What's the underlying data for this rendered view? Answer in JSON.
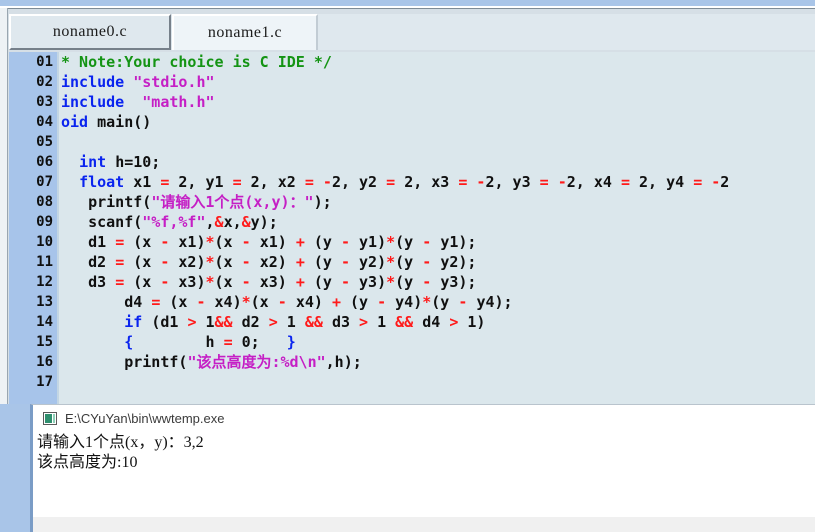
{
  "window": {
    "tabs": [
      {
        "label": "noname0.c",
        "active": false
      },
      {
        "label": "noname1.c",
        "active": true
      }
    ]
  },
  "editor": {
    "scrolled_horizontally": true,
    "lines": [
      {
        "num": "01",
        "segments": [
          {
            "text": "* Note:Your choice is C IDE */",
            "cls": "cm"
          }
        ]
      },
      {
        "num": "02",
        "segments": [
          {
            "text": "include ",
            "cls": "kw"
          },
          {
            "text": "\"stdio.h\"",
            "cls": "str"
          }
        ]
      },
      {
        "num": "03",
        "segments": [
          {
            "text": "include  ",
            "cls": "kw"
          },
          {
            "text": "\"math.h\"",
            "cls": "str"
          }
        ]
      },
      {
        "num": "04",
        "segments": [
          {
            "text": "oid ",
            "cls": "kw"
          },
          {
            "text": "main()",
            "cls": "pl"
          }
        ]
      },
      {
        "num": "05",
        "segments": [
          {
            "text": "",
            "cls": "pl"
          }
        ]
      },
      {
        "num": "06",
        "segments": [
          {
            "text": "  ",
            "cls": "pl"
          },
          {
            "text": "int ",
            "cls": "kw"
          },
          {
            "text": "h=10;",
            "cls": "pl"
          }
        ]
      },
      {
        "num": "07",
        "segments": [
          {
            "text": "  ",
            "cls": "pl"
          },
          {
            "text": "float ",
            "cls": "kw"
          },
          {
            "text": "x1 ",
            "cls": "pl"
          },
          {
            "text": "= ",
            "cls": "op"
          },
          {
            "text": "2, y1 ",
            "cls": "pl"
          },
          {
            "text": "= ",
            "cls": "op"
          },
          {
            "text": "2, x2 ",
            "cls": "pl"
          },
          {
            "text": "= -",
            "cls": "op"
          },
          {
            "text": "2, y2 ",
            "cls": "pl"
          },
          {
            "text": "= ",
            "cls": "op"
          },
          {
            "text": "2, x3 ",
            "cls": "pl"
          },
          {
            "text": "= -",
            "cls": "op"
          },
          {
            "text": "2, y3 ",
            "cls": "pl"
          },
          {
            "text": "= -",
            "cls": "op"
          },
          {
            "text": "2, x4 ",
            "cls": "pl"
          },
          {
            "text": "= ",
            "cls": "op"
          },
          {
            "text": "2, y4 ",
            "cls": "pl"
          },
          {
            "text": "= -",
            "cls": "op"
          },
          {
            "text": "2",
            "cls": "pl"
          }
        ]
      },
      {
        "num": "08",
        "segments": [
          {
            "text": "   printf(",
            "cls": "pl"
          },
          {
            "text": "\"请输入1个点(x,y)：\"",
            "cls": "str"
          },
          {
            "text": ");",
            "cls": "pl"
          }
        ]
      },
      {
        "num": "09",
        "segments": [
          {
            "text": "   scanf(",
            "cls": "pl"
          },
          {
            "text": "\"%f,%f\"",
            "cls": "str"
          },
          {
            "text": ",",
            "cls": "pl"
          },
          {
            "text": "&",
            "cls": "op"
          },
          {
            "text": "x,",
            "cls": "pl"
          },
          {
            "text": "&",
            "cls": "op"
          },
          {
            "text": "y);",
            "cls": "pl"
          }
        ]
      },
      {
        "num": "10",
        "segments": [
          {
            "text": "   d1 ",
            "cls": "pl"
          },
          {
            "text": "= ",
            "cls": "op"
          },
          {
            "text": "(x ",
            "cls": "pl"
          },
          {
            "text": "- ",
            "cls": "op"
          },
          {
            "text": "x1)",
            "cls": "pl"
          },
          {
            "text": "*",
            "cls": "op"
          },
          {
            "text": "(x ",
            "cls": "pl"
          },
          {
            "text": "- ",
            "cls": "op"
          },
          {
            "text": "x1) ",
            "cls": "pl"
          },
          {
            "text": "+ ",
            "cls": "op"
          },
          {
            "text": "(y ",
            "cls": "pl"
          },
          {
            "text": "- ",
            "cls": "op"
          },
          {
            "text": "y1)",
            "cls": "pl"
          },
          {
            "text": "*",
            "cls": "op"
          },
          {
            "text": "(y ",
            "cls": "pl"
          },
          {
            "text": "- ",
            "cls": "op"
          },
          {
            "text": "y1);",
            "cls": "pl"
          }
        ]
      },
      {
        "num": "11",
        "segments": [
          {
            "text": "   d2 ",
            "cls": "pl"
          },
          {
            "text": "= ",
            "cls": "op"
          },
          {
            "text": "(x ",
            "cls": "pl"
          },
          {
            "text": "- ",
            "cls": "op"
          },
          {
            "text": "x2)",
            "cls": "pl"
          },
          {
            "text": "*",
            "cls": "op"
          },
          {
            "text": "(x ",
            "cls": "pl"
          },
          {
            "text": "- ",
            "cls": "op"
          },
          {
            "text": "x2) ",
            "cls": "pl"
          },
          {
            "text": "+ ",
            "cls": "op"
          },
          {
            "text": "(y ",
            "cls": "pl"
          },
          {
            "text": "- ",
            "cls": "op"
          },
          {
            "text": "y2)",
            "cls": "pl"
          },
          {
            "text": "*",
            "cls": "op"
          },
          {
            "text": "(y ",
            "cls": "pl"
          },
          {
            "text": "- ",
            "cls": "op"
          },
          {
            "text": "y2);",
            "cls": "pl"
          }
        ]
      },
      {
        "num": "12",
        "segments": [
          {
            "text": "   d3 ",
            "cls": "pl"
          },
          {
            "text": "= ",
            "cls": "op"
          },
          {
            "text": "(x ",
            "cls": "pl"
          },
          {
            "text": "- ",
            "cls": "op"
          },
          {
            "text": "x3)",
            "cls": "pl"
          },
          {
            "text": "*",
            "cls": "op"
          },
          {
            "text": "(x ",
            "cls": "pl"
          },
          {
            "text": "- ",
            "cls": "op"
          },
          {
            "text": "x3) ",
            "cls": "pl"
          },
          {
            "text": "+ ",
            "cls": "op"
          },
          {
            "text": "(y ",
            "cls": "pl"
          },
          {
            "text": "- ",
            "cls": "op"
          },
          {
            "text": "y3)",
            "cls": "pl"
          },
          {
            "text": "*",
            "cls": "op"
          },
          {
            "text": "(y ",
            "cls": "pl"
          },
          {
            "text": "- ",
            "cls": "op"
          },
          {
            "text": "y3);",
            "cls": "pl"
          }
        ]
      },
      {
        "num": "13",
        "segments": [
          {
            "text": "       d4 ",
            "cls": "pl"
          },
          {
            "text": "= ",
            "cls": "op"
          },
          {
            "text": "(x ",
            "cls": "pl"
          },
          {
            "text": "- ",
            "cls": "op"
          },
          {
            "text": "x4)",
            "cls": "pl"
          },
          {
            "text": "*",
            "cls": "op"
          },
          {
            "text": "(x ",
            "cls": "pl"
          },
          {
            "text": "- ",
            "cls": "op"
          },
          {
            "text": "x4) ",
            "cls": "pl"
          },
          {
            "text": "+ ",
            "cls": "op"
          },
          {
            "text": "(y ",
            "cls": "pl"
          },
          {
            "text": "- ",
            "cls": "op"
          },
          {
            "text": "y4)",
            "cls": "pl"
          },
          {
            "text": "*",
            "cls": "op"
          },
          {
            "text": "(y ",
            "cls": "pl"
          },
          {
            "text": "- ",
            "cls": "op"
          },
          {
            "text": "y4);",
            "cls": "pl"
          }
        ]
      },
      {
        "num": "14",
        "segments": [
          {
            "text": "       ",
            "cls": "pl"
          },
          {
            "text": "if ",
            "cls": "kw"
          },
          {
            "text": "(d1 ",
            "cls": "pl"
          },
          {
            "text": "> ",
            "cls": "op"
          },
          {
            "text": "1",
            "cls": "pl"
          },
          {
            "text": "&& ",
            "cls": "op"
          },
          {
            "text": "d2 ",
            "cls": "pl"
          },
          {
            "text": "> ",
            "cls": "op"
          },
          {
            "text": "1 ",
            "cls": "pl"
          },
          {
            "text": "&& ",
            "cls": "op"
          },
          {
            "text": "d3 ",
            "cls": "pl"
          },
          {
            "text": "> ",
            "cls": "op"
          },
          {
            "text": "1 ",
            "cls": "pl"
          },
          {
            "text": "&& ",
            "cls": "op"
          },
          {
            "text": "d4 ",
            "cls": "pl"
          },
          {
            "text": "> ",
            "cls": "op"
          },
          {
            "text": "1)",
            "cls": "pl"
          }
        ]
      },
      {
        "num": "15",
        "segments": [
          {
            "text": "       ",
            "cls": "pl"
          },
          {
            "text": "{",
            "cls": "kw"
          },
          {
            "text": "        h ",
            "cls": "pl"
          },
          {
            "text": "= ",
            "cls": "op"
          },
          {
            "text": "0;   ",
            "cls": "pl"
          },
          {
            "text": "}",
            "cls": "kw"
          }
        ]
      },
      {
        "num": "16",
        "segments": [
          {
            "text": "       printf(",
            "cls": "pl"
          },
          {
            "text": "\"该点高度为:%d\\n\"",
            "cls": "str"
          },
          {
            "text": ",h);",
            "cls": "pl"
          }
        ]
      },
      {
        "num": "17",
        "segments": [
          {
            "text": "",
            "cls": "pl"
          }
        ]
      }
    ]
  },
  "console": {
    "title": "E:\\CYuYan\\bin\\wwtemp.exe",
    "output": [
      "请输入1个点(x，y)：3,2",
      "该点高度为:10"
    ]
  }
}
